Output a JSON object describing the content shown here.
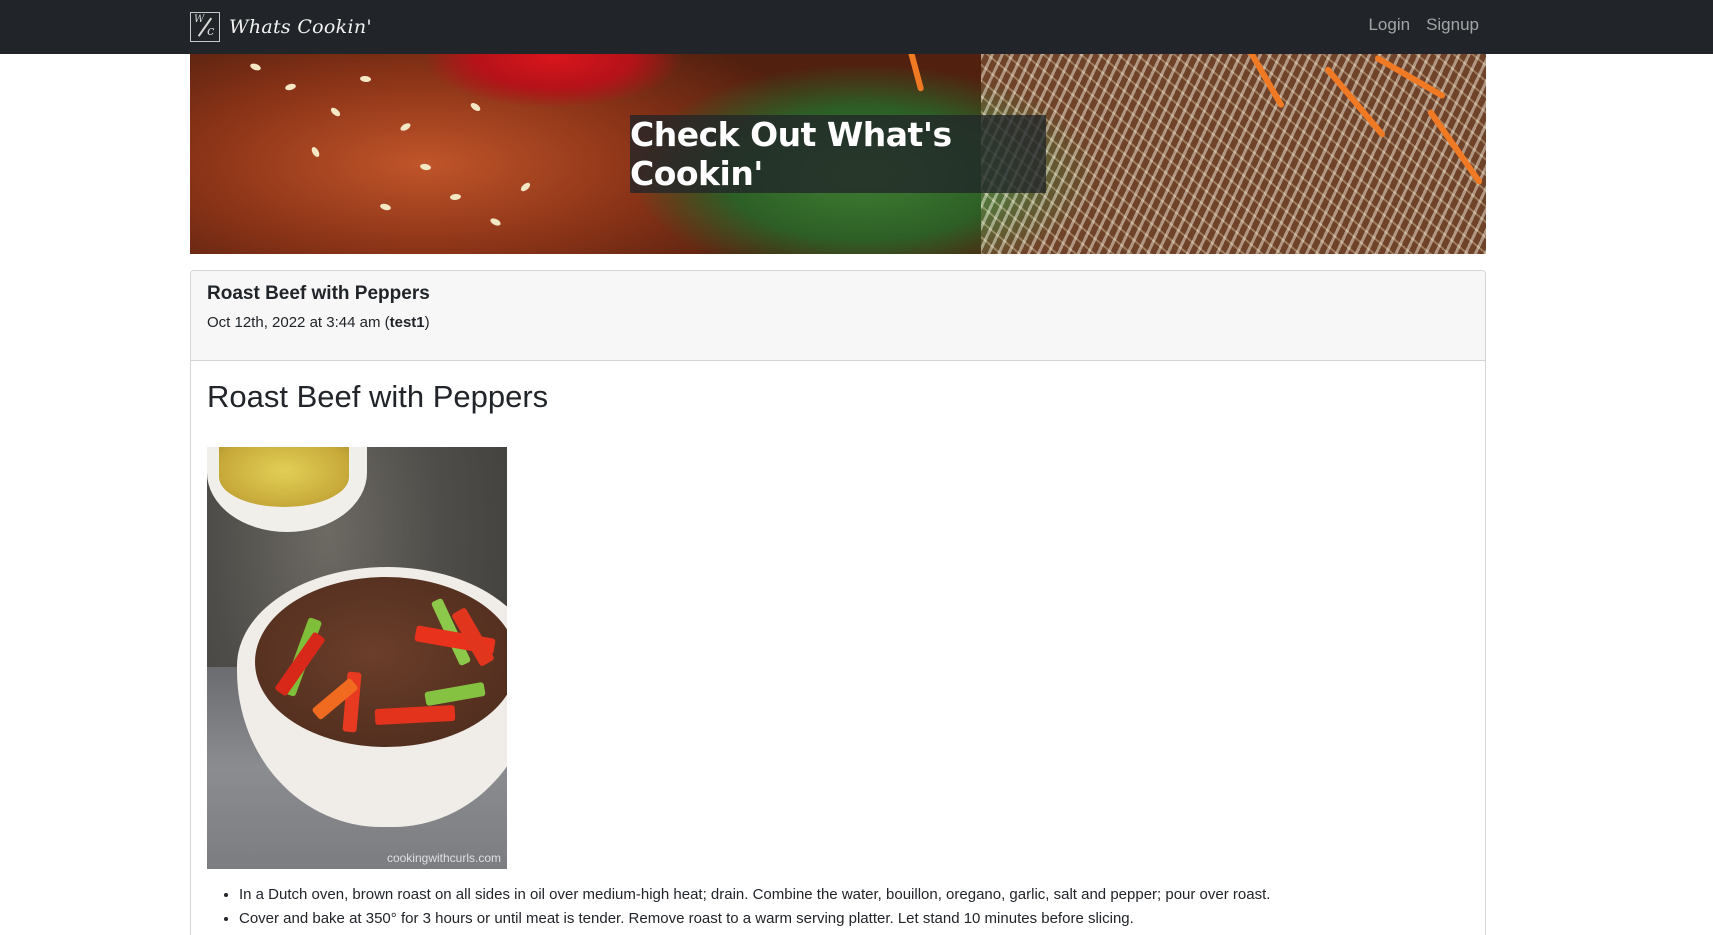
{
  "navbar": {
    "brand_logo_text": "W/c",
    "brand_name": "Whats Cookin'",
    "links": [
      {
        "label": "Login"
      },
      {
        "label": "Signup"
      }
    ]
  },
  "hero": {
    "title": "Check Out What's Cookin'"
  },
  "post": {
    "header_title": "Roast Beef with Peppers",
    "date": "Oct 12th, 2022 at 3:44 am",
    "author": "test1",
    "heading": "Roast Beef with Peppers",
    "photo_watermark": "cookingwithcurls.com",
    "steps": [
      "In a Dutch oven, brown roast on all sides in oil over medium-high heat; drain. Combine the water, bouillon, oregano, garlic, salt and pepper; pour over roast.",
      "Cover and bake at 350° for 3 hours or until meat is tender. Remove roast to a warm serving platter. Let stand 10 minutes before slicing."
    ]
  },
  "colors": {
    "navbar_bg": "#212529",
    "card_header_bg": "#f7f7f7",
    "text": "#212529"
  }
}
